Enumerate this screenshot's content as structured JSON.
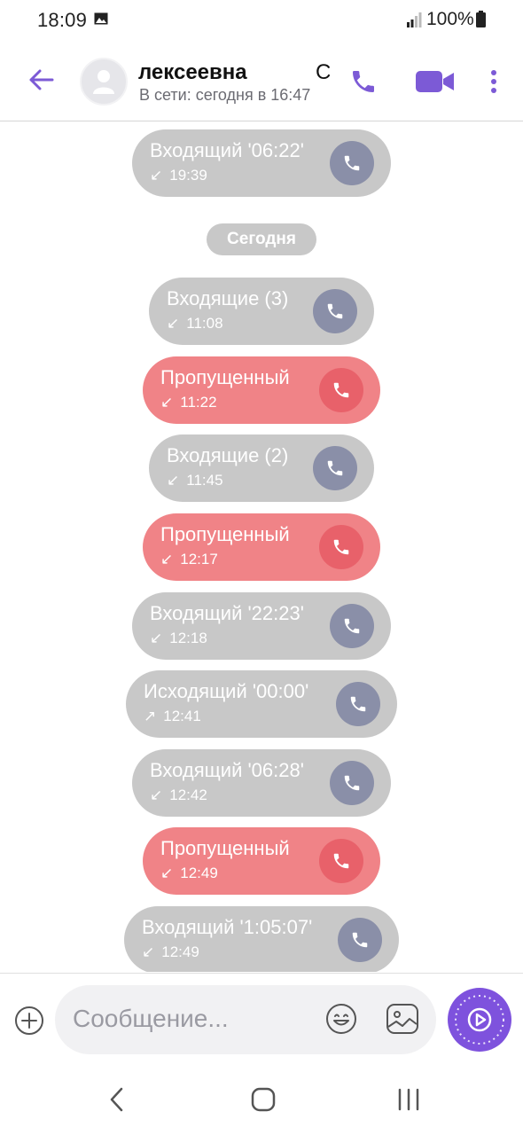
{
  "status_bar": {
    "time": "18:09",
    "battery_percent": "100%"
  },
  "header": {
    "contact_name": "лексеевна",
    "contact_name_tail": "С",
    "online_status": "В сети: сегодня в 16:47",
    "icons": [
      "back-arrow-icon",
      "avatar-icon",
      "phone-icon",
      "video-camera-icon",
      "more-vertical-icon"
    ]
  },
  "chat": {
    "calls_before": [
      {
        "title": "Входящий '06:22'",
        "time": "19:39",
        "kind": "incoming",
        "arrow": "↙"
      }
    ],
    "date_separator": "Сегодня",
    "calls_today": [
      {
        "title": "Входящие (3)",
        "time": "11:08",
        "kind": "incoming",
        "arrow": "↙"
      },
      {
        "title": "Пропущенный",
        "time": "11:22",
        "kind": "missed",
        "arrow": "↙"
      },
      {
        "title": "Входящие (2)",
        "time": "11:45",
        "kind": "incoming",
        "arrow": "↙"
      },
      {
        "title": "Пропущенный",
        "time": "12:17",
        "kind": "missed",
        "arrow": "↙"
      },
      {
        "title": "Входящий '22:23'",
        "time": "12:18",
        "kind": "incoming",
        "arrow": "↙"
      },
      {
        "title": "Исходящий '00:00'",
        "time": "12:41",
        "kind": "outgoing",
        "arrow": "↗"
      },
      {
        "title": "Входящий '06:28'",
        "time": "12:42",
        "kind": "incoming",
        "arrow": "↙"
      },
      {
        "title": "Пропущенный",
        "time": "12:49",
        "kind": "missed",
        "arrow": "↙"
      },
      {
        "title": "Входящий '1:05:07'",
        "time": "12:49",
        "kind": "incoming",
        "arrow": "↙"
      }
    ]
  },
  "input_bar": {
    "placeholder": "Сообщение...",
    "value": "",
    "icons": [
      "plus-circle-icon",
      "emoji-icon",
      "sticker-icon",
      "send-icon"
    ]
  },
  "nav_bar": {
    "icons": [
      "nav-back-icon",
      "nav-home-icon",
      "nav-recents-icon"
    ]
  },
  "colors": {
    "accent": "#7e52dd",
    "incoming_bubble": "#c8c8c8",
    "missed_bubble": "#f08387",
    "call_icon_circle": "#8a8fa8",
    "missed_icon_circle": "#e8616a"
  }
}
